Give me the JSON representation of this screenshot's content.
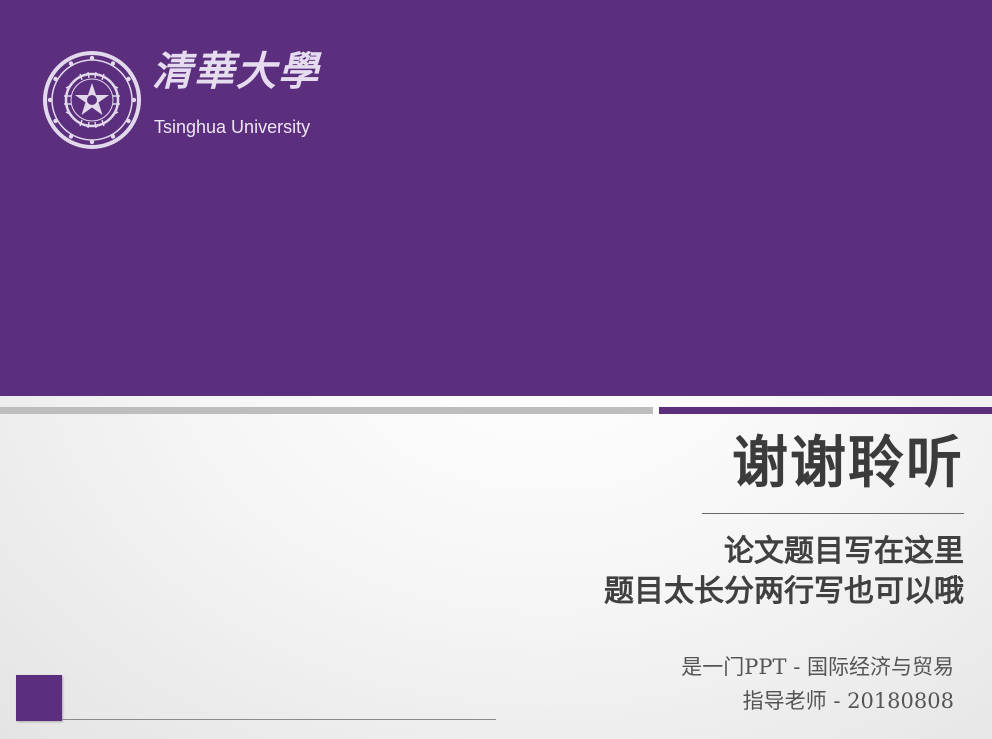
{
  "brand": {
    "name_cn": "清華大學",
    "name_en": "Tsinghua University",
    "accent_color": "#5b2f7d",
    "seal_icon": "university-seal-icon"
  },
  "slide": {
    "title": "谢谢聆听",
    "subtitle_lines": [
      "论文题目写在这里",
      "题目太长分两行写也可以哦"
    ],
    "meta_lines": [
      "是一门PPT - 国际经济与贸易",
      "指导老师 - 20180808"
    ]
  }
}
